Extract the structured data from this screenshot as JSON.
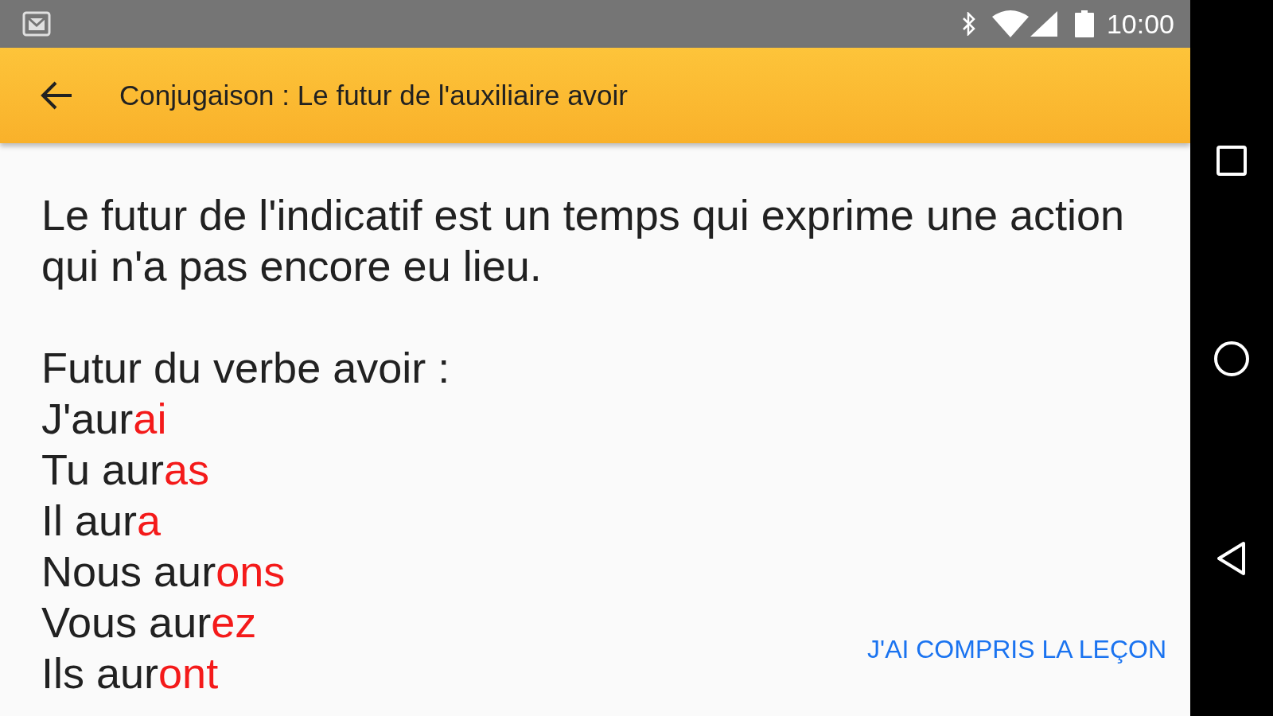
{
  "status_bar": {
    "time": "10:00"
  },
  "app_bar": {
    "title": "Conjugaison : Le futur de l'auxiliaire avoir"
  },
  "lesson": {
    "intro": "Le futur de l'indicatif est un temps qui exprime une action qui n'a pas encore eu lieu.",
    "heading": "Futur du verbe avoir :",
    "conjugations": [
      {
        "stem": "J'aur",
        "ending": "ai"
      },
      {
        "stem": "Tu aur",
        "ending": "as"
      },
      {
        "stem": "Il aur",
        "ending": "a"
      },
      {
        "stem": "Nous aur",
        "ending": "ons"
      },
      {
        "stem": "Vous aur",
        "ending": "ez"
      },
      {
        "stem": "Ils aur",
        "ending": "ont"
      }
    ]
  },
  "action_button": {
    "label": "J'AI COMPRIS LA LEÇON"
  }
}
